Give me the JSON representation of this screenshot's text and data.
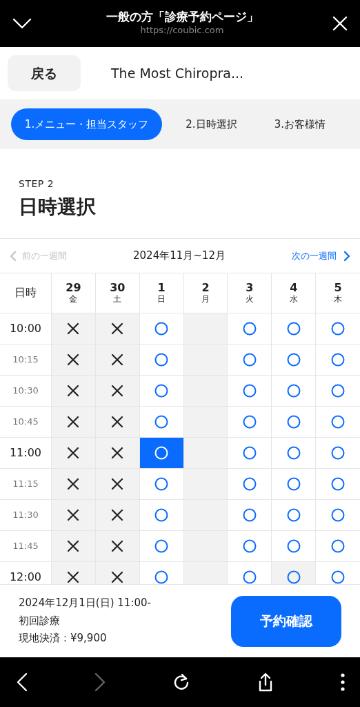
{
  "browser_bar": {
    "title": "一般の方「診療予約ページ」",
    "url": "https://coubic.com"
  },
  "header": {
    "back": "戻る",
    "title": "The Most Chiropra..."
  },
  "steps": [
    {
      "label": "1.メニュー・担当スタッフ",
      "selected": true
    },
    {
      "label": "2.日時選択",
      "selected": false
    },
    {
      "label": "3.お客様情",
      "selected": false
    }
  ],
  "step_heading": {
    "step": "STEP 2",
    "title": "日時選択"
  },
  "week_nav": {
    "prev": "前の一週間",
    "prev_disabled": true,
    "range": "2024年11月~12月",
    "next": "次の一週間"
  },
  "table": {
    "corner": "日時",
    "days": [
      {
        "date": "29",
        "weekday": "金"
      },
      {
        "date": "30",
        "weekday": "土"
      },
      {
        "date": "1",
        "weekday": "日"
      },
      {
        "date": "2",
        "weekday": "月"
      },
      {
        "date": "3",
        "weekday": "火"
      },
      {
        "date": "4",
        "weekday": "水"
      },
      {
        "date": "5",
        "weekday": "木"
      }
    ],
    "rows": [
      {
        "time": "10:00",
        "kind": "hour",
        "cells": [
          {
            "kind": "full",
            "selected": false
          },
          {
            "kind": "full",
            "selected": false
          },
          {
            "kind": "open",
            "selected": false
          },
          {
            "kind": "closed",
            "selected": false
          },
          {
            "kind": "open",
            "selected": false
          },
          {
            "kind": "open",
            "selected": false
          },
          {
            "kind": "open",
            "selected": false
          }
        ]
      },
      {
        "time": "10:15",
        "kind": "quarter",
        "cells": [
          {
            "kind": "full",
            "selected": false
          },
          {
            "kind": "full",
            "selected": false
          },
          {
            "kind": "open",
            "selected": false
          },
          {
            "kind": "closed",
            "selected": false
          },
          {
            "kind": "open",
            "selected": false
          },
          {
            "kind": "open",
            "selected": false
          },
          {
            "kind": "open",
            "selected": false
          }
        ]
      },
      {
        "time": "10:30",
        "kind": "quarter",
        "cells": [
          {
            "kind": "full",
            "selected": false
          },
          {
            "kind": "full",
            "selected": false
          },
          {
            "kind": "open",
            "selected": false
          },
          {
            "kind": "closed",
            "selected": false
          },
          {
            "kind": "open",
            "selected": false
          },
          {
            "kind": "open",
            "selected": false
          },
          {
            "kind": "open",
            "selected": false
          }
        ]
      },
      {
        "time": "10:45",
        "kind": "quarter",
        "cells": [
          {
            "kind": "full",
            "selected": false
          },
          {
            "kind": "full",
            "selected": false
          },
          {
            "kind": "open",
            "selected": false
          },
          {
            "kind": "closed",
            "selected": false
          },
          {
            "kind": "open",
            "selected": false
          },
          {
            "kind": "open",
            "selected": false
          },
          {
            "kind": "open",
            "selected": false
          }
        ]
      },
      {
        "time": "11:00",
        "kind": "hour",
        "cells": [
          {
            "kind": "full",
            "selected": false
          },
          {
            "kind": "full",
            "selected": false
          },
          {
            "kind": "open",
            "selected": true
          },
          {
            "kind": "closed",
            "selected": false
          },
          {
            "kind": "open",
            "selected": false
          },
          {
            "kind": "open",
            "selected": false
          },
          {
            "kind": "open",
            "selected": false
          }
        ]
      },
      {
        "time": "11:15",
        "kind": "quarter",
        "cells": [
          {
            "kind": "full",
            "selected": false
          },
          {
            "kind": "full",
            "selected": false
          },
          {
            "kind": "open",
            "selected": false
          },
          {
            "kind": "closed",
            "selected": false
          },
          {
            "kind": "open",
            "selected": false
          },
          {
            "kind": "open",
            "selected": false
          },
          {
            "kind": "open",
            "selected": false
          }
        ]
      },
      {
        "time": "11:30",
        "kind": "quarter",
        "cells": [
          {
            "kind": "full",
            "selected": false
          },
          {
            "kind": "full",
            "selected": false
          },
          {
            "kind": "open",
            "selected": false
          },
          {
            "kind": "closed",
            "selected": false
          },
          {
            "kind": "open",
            "selected": false
          },
          {
            "kind": "open",
            "selected": false
          },
          {
            "kind": "open",
            "selected": false
          }
        ]
      },
      {
        "time": "11:45",
        "kind": "quarter",
        "cells": [
          {
            "kind": "full",
            "selected": false
          },
          {
            "kind": "full",
            "selected": false
          },
          {
            "kind": "open",
            "selected": false
          },
          {
            "kind": "closed",
            "selected": false
          },
          {
            "kind": "open",
            "selected": false
          },
          {
            "kind": "open",
            "selected": false
          },
          {
            "kind": "open",
            "selected": false
          }
        ]
      },
      {
        "time": "12:00",
        "kind": "hour",
        "cells": [
          {
            "kind": "full",
            "selected": false
          },
          {
            "kind": "full",
            "selected": false
          },
          {
            "kind": "open",
            "selected": false
          },
          {
            "kind": "closed",
            "selected": false
          },
          {
            "kind": "open",
            "selected": false
          },
          {
            "kind": "shaded",
            "selected": false
          },
          {
            "kind": "open",
            "selected": false
          }
        ]
      }
    ]
  },
  "summary": {
    "lines": [
      "2024年12月1日(日) 11:00-",
      "初回診療",
      "現地決済：¥9,900"
    ],
    "button": "予約確認"
  }
}
